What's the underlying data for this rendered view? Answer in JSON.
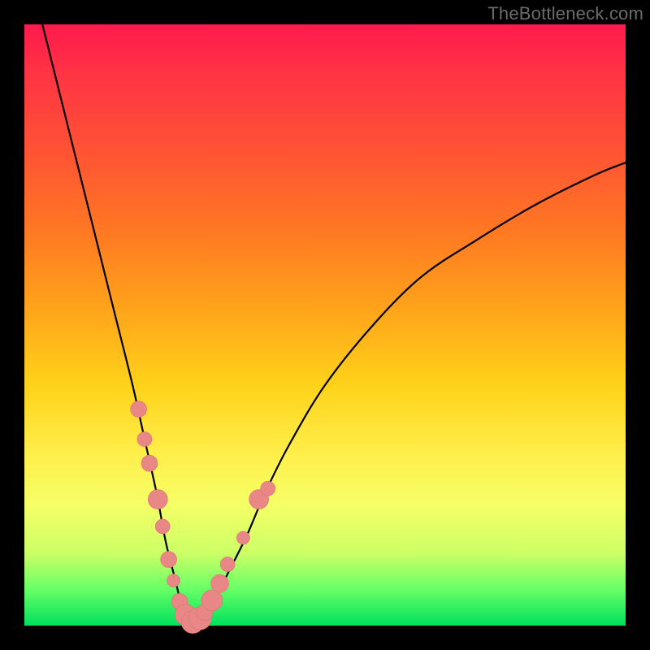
{
  "watermark": "TheBottleneck.com",
  "chart_data": {
    "type": "line",
    "title": "",
    "xlabel": "",
    "ylabel": "",
    "xlim": [
      0,
      100
    ],
    "ylim": [
      0,
      100
    ],
    "grid": false,
    "legend": false,
    "series": [
      {
        "name": "bottleneck-curve",
        "x": [
          3,
          6,
          9,
          12,
          15,
          18,
          20,
          22,
          23.5,
          25,
          26,
          27,
          28.5,
          30,
          32,
          34,
          37,
          40,
          44,
          50,
          58,
          66,
          75,
          85,
          95,
          100
        ],
        "y": [
          100,
          88,
          76,
          64,
          52,
          40,
          31,
          22,
          14,
          8,
          4,
          1.5,
          0.5,
          1.5,
          5,
          9,
          15,
          22,
          30,
          40,
          50,
          58,
          64,
          70,
          75,
          77
        ]
      }
    ],
    "points": {
      "name": "highlight-dots",
      "x": [
        19.0,
        20.0,
        20.8,
        22.2,
        23.0,
        24.0,
        24.8,
        25.8,
        26.8,
        28.0,
        29.2,
        30.0,
        31.2,
        32.5,
        33.8,
        36.4,
        39.0,
        40.5
      ],
      "y": [
        36.0,
        31.0,
        27.0,
        21.0,
        16.5,
        11.0,
        7.5,
        4.0,
        1.8,
        0.6,
        1.2,
        2.2,
        4.2,
        7.0,
        10.2,
        14.6,
        21.0,
        22.8
      ],
      "r": [
        10,
        9,
        10,
        12,
        9,
        10,
        8,
        10,
        13,
        14,
        14,
        10,
        13,
        11,
        9,
        8,
        12,
        9
      ]
    },
    "colors": {
      "curve": "#000000",
      "dot_fill": "#e98787",
      "dot_stroke": "#da7272",
      "gradient_top": "#ff1a4d",
      "gradient_mid": "#fff04d",
      "gradient_bottom": "#00e05c",
      "frame": "#000000"
    }
  }
}
